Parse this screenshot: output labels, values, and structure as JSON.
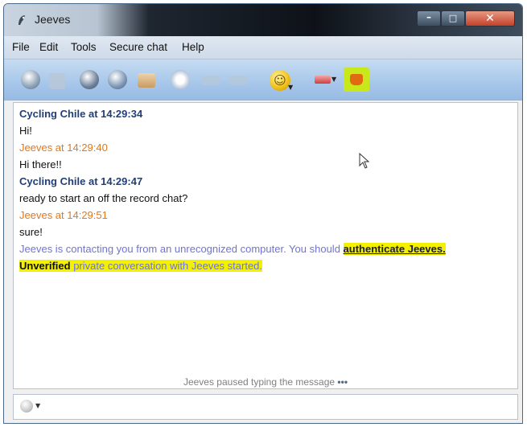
{
  "window": {
    "title": "Jeeves"
  },
  "window_controls": {
    "minimize": "–",
    "maximize": "□",
    "close": "✕"
  },
  "menu": [
    "File",
    "Edit",
    "Tools",
    "Secure chat",
    "Help"
  ],
  "toolbar": {
    "icons": [
      "globe-icon",
      "lock-icon",
      "history-icon",
      "profile-icon",
      "send-file-icon",
      "clock-icon",
      "arrow-left-icon",
      "arrow-right-icon",
      "smiley-icon",
      "webcam-icon",
      "otr-icon"
    ],
    "smiley_face": "☺",
    "caret": "▼",
    "otr_highlight_color": "#c8e81c"
  },
  "chat": {
    "lines": [
      {
        "kind": "remote",
        "text": "Cycling Chile at 14:29:34"
      },
      {
        "kind": "msg",
        "text": "Hi!"
      },
      {
        "kind": "local",
        "text": "Jeeves at 14:29:40"
      },
      {
        "kind": "msg",
        "text": "Hi there!!"
      },
      {
        "kind": "remote",
        "text": "Cycling Chile at 14:29:47"
      },
      {
        "kind": "msg",
        "text": "ready to start an off the record chat?"
      },
      {
        "kind": "local",
        "text": "Jeeves at 14:29:51"
      },
      {
        "kind": "msg",
        "text": "sure!"
      }
    ],
    "system_line_1": {
      "text": "Jeeves is contacting you from an unrecognized computer. You should ",
      "link": "authenticate Jeeves."
    },
    "system_line_2": {
      "bold": "Unverified",
      "text": " private conversation with Jeeves started."
    },
    "typing_status": "Jeeves paused typing the message",
    "typing_dots": "•••"
  },
  "input": {
    "caret": "▼"
  },
  "colors": {
    "remote_name": "#1f3f78",
    "local_name": "#e0781c",
    "system_text": "#6f74d3",
    "highlight": "#f3f000"
  }
}
